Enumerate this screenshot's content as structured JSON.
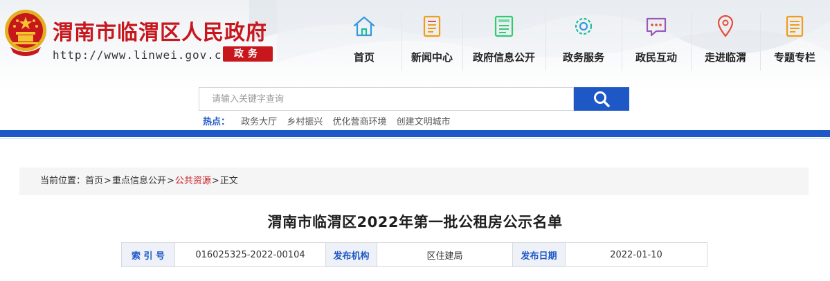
{
  "header": {
    "site_title": "渭南市临渭区人民政府",
    "site_url": "http://www.linwei.gov.cn",
    "badge": "政务",
    "nav": [
      {
        "label": "首页",
        "icon": "home-icon"
      },
      {
        "label": "新闻中心",
        "icon": "news-document-icon"
      },
      {
        "label": "政府信息公开",
        "icon": "info-document-icon"
      },
      {
        "label": "政务服务",
        "icon": "gear-icon"
      },
      {
        "label": "政民互动",
        "icon": "chat-bubble-icon"
      },
      {
        "label": "走进临渭",
        "icon": "location-pin-icon"
      },
      {
        "label": "专题专栏",
        "icon": "list-document-icon"
      }
    ],
    "colors": {
      "brand_red": "#c8161d",
      "brand_blue": "#1e57c6",
      "icon_red": "#e74c3c",
      "icon_orange": "#f39c12",
      "icon_green": "#2ecc71",
      "icon_teal": "#1abc9c",
      "icon_purple": "#9b59b6",
      "icon_blue": "#3498db"
    }
  },
  "search": {
    "placeholder": "请输入关键字查询",
    "button_icon": "search-icon"
  },
  "hot": {
    "label": "热点：",
    "links": [
      "政务大厅",
      "乡村振兴",
      "优化营商环境",
      "创建文明城市"
    ]
  },
  "breadcrumb": {
    "prefix": "当前位置：",
    "items": [
      "首页",
      "重点信息公开",
      "公共资源",
      "正文"
    ],
    "separator": ">"
  },
  "article": {
    "title": "渭南市临渭区2022年第一批公租房公示名单",
    "meta": {
      "index_label": "索 引 号",
      "index_value": "016025325-2022-00104",
      "org_label": "发布机构",
      "org_value": "区住建局",
      "date_label": "发布日期",
      "date_value": "2022-01-10"
    }
  }
}
